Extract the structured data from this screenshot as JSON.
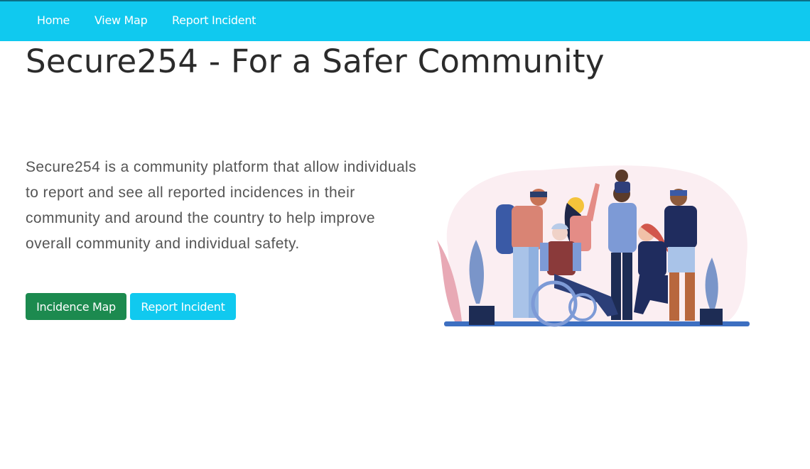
{
  "nav": {
    "items": [
      {
        "label": "Home"
      },
      {
        "label": "View Map"
      },
      {
        "label": "Report Incident"
      }
    ]
  },
  "hero": {
    "title": "Secure254 - For a Safer Community",
    "description": "Secure254 is a community platform that allow individuals to report and see all reported incidences in their community and around the country to help improve overall community and individual safety.",
    "buttons": {
      "incidence_map": "Incidence Map",
      "report_incident": "Report Incident"
    },
    "illustration": "community-people-illustration"
  },
  "colors": {
    "navbar": "#10c9ef",
    "primary_button": "#1c8a4f",
    "secondary_button": "#10c9ef"
  }
}
